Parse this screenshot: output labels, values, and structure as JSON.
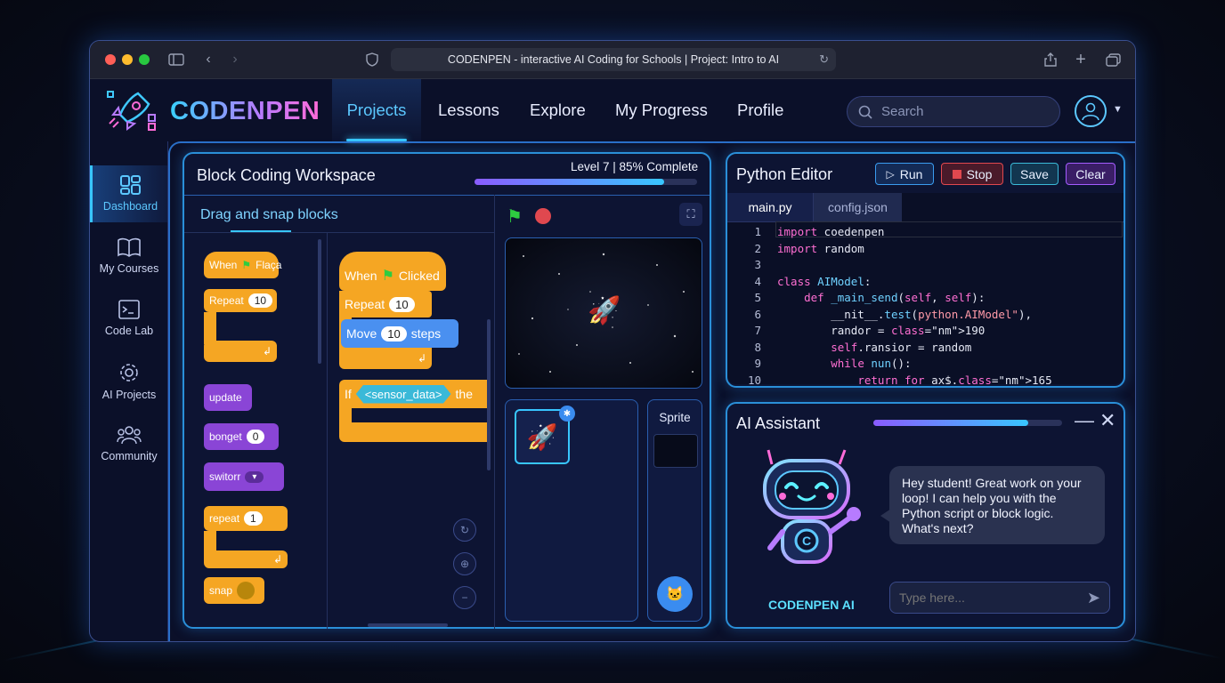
{
  "browser": {
    "url": "CODENPEN - interactive AI Coding for Schools | Project: Intro to AI"
  },
  "app": {
    "name": "CODENPEN"
  },
  "nav": [
    "Projects",
    "Lessons",
    "Explore",
    "My Progress",
    "Profile"
  ],
  "search": {
    "placeholder": "Search"
  },
  "sidebar": [
    {
      "label": "Dashboard",
      "icon": "dashboard-icon"
    },
    {
      "label": "My Courses",
      "icon": "book-icon"
    },
    {
      "label": "Code Lab",
      "icon": "terminal-icon"
    },
    {
      "label": "AI Projects",
      "icon": "gear-icon"
    },
    {
      "label": "Community",
      "icon": "people-icon"
    }
  ],
  "workspace": {
    "title": "Block Coding Workspace",
    "progress_text": "Level 7 | 85% Complete",
    "progress": 0.85,
    "tab": "Drag and snap blocks",
    "palette": {
      "when": "When",
      "flag_label": "Flaça",
      "repeat": "Repeat",
      "repeat_val": "10",
      "update": "update",
      "bonget": "bonget",
      "bonget_val": "0",
      "switorr": "switorr",
      "repeat2": "repeat",
      "repeat2_val": "1",
      "snap": "snap"
    },
    "script": {
      "when": "When",
      "clicked": "Clicked",
      "repeat": "Repeat",
      "repeat_val": "10",
      "move": "Move",
      "move_val": "10",
      "steps": "steps",
      "if": "If",
      "sensor": "<sensor_data>",
      "then": "the"
    },
    "sprite_label": "Sprite"
  },
  "editor": {
    "title": "Python Editor",
    "buttons": {
      "run": "Run",
      "stop": "Stop",
      "save": "Save",
      "clear": "Clear"
    },
    "tabs": [
      "main.py",
      "config.json"
    ],
    "line_numbers": [
      "1",
      "2",
      "3",
      "4",
      "5",
      "6",
      "7",
      "8",
      "9",
      "10"
    ],
    "lines": [
      "import coedenpen",
      "import random",
      "",
      "class AIModel:",
      "    def _main_send(self, self):",
      "        __nit__.test(python.AIModel\"),",
      "        randor = 190",
      "        self.ransior = random",
      "        while nun():",
      "            return for ax$.165"
    ]
  },
  "assistant": {
    "title": "AI Assistant",
    "progress": 0.82,
    "message": "Hey student! Great work on your loop! I can help you with the Python script or block logic. What's next?",
    "bot_name": "CODENPEN AI",
    "input_placeholder": "Type here..."
  },
  "colors": {
    "accent": "#38c6ff",
    "block": "#f5a623",
    "stop": "#e0484f",
    "purple": "#8a45d6"
  }
}
